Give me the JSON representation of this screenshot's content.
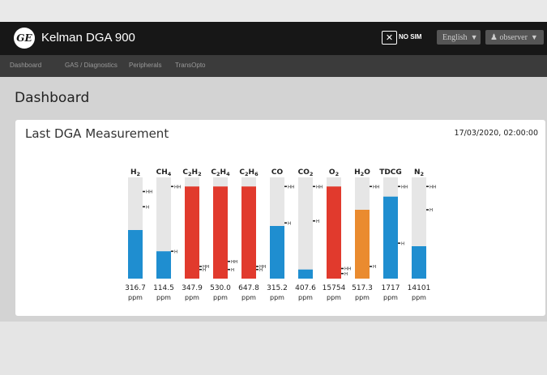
{
  "app": {
    "title": "Kelman DGA 900",
    "logo_text": "GE",
    "nosim_label": "NO SIM",
    "language": "English",
    "user": "observer"
  },
  "nav": [
    "Dashboard",
    "GAS / Diagnostics",
    "Peripherals",
    "TransOpto"
  ],
  "page": {
    "title": "Dashboard"
  },
  "card": {
    "title": "Last DGA Measurement",
    "timestamp": "17/03/2020, 02:00:00"
  },
  "colors": {
    "blue": "#1f8ed0",
    "red": "#e13a2d",
    "orange": "#ea8b2f",
    "track": "#e6e6e6"
  },
  "gases": [
    {
      "sym": "H",
      "sub": "2",
      "value": "316.7",
      "unit": "ppm",
      "fill": 0.48,
      "color": "blue",
      "hh": 0.86,
      "h": 0.71
    },
    {
      "sym": "CH",
      "sub": "4",
      "value": "114.5",
      "unit": "ppm",
      "fill": 0.27,
      "color": "blue",
      "hh": 0.91,
      "h": 0.27
    },
    {
      "sym": "C",
      "sub": "2",
      "sym2": "H",
      "sub2": "2",
      "value": "347.9",
      "unit": "ppm",
      "fill": 0.91,
      "color": "red",
      "hh": 0.12,
      "h": 0.09
    },
    {
      "sym": "C",
      "sub": "2",
      "sym2": "H",
      "sub2": "4",
      "value": "530.0",
      "unit": "ppm",
      "fill": 0.91,
      "color": "red",
      "hh": 0.17,
      "h": 0.09
    },
    {
      "sym": "C",
      "sub": "2",
      "sym2": "H",
      "sub2": "6",
      "value": "647.8",
      "unit": "ppm",
      "fill": 0.91,
      "color": "red",
      "hh": 0.12,
      "h": 0.09
    },
    {
      "sym": "CO",
      "sub": "",
      "value": "315.2",
      "unit": "ppm",
      "fill": 0.52,
      "color": "blue",
      "hh": 0.91,
      "h": 0.55
    },
    {
      "sym": "CO",
      "sub": "2",
      "value": "407.6",
      "unit": "ppm",
      "fill": 0.09,
      "color": "blue",
      "hh": 0.91,
      "h": 0.57
    },
    {
      "sym": "O",
      "sub": "2",
      "value": "15754",
      "unit": "ppm",
      "fill": 0.91,
      "color": "red",
      "hh": 0.1,
      "h": 0.05
    },
    {
      "sym": "H",
      "sub": "2",
      "sym2": "O",
      "sub2": "",
      "value": "517.3",
      "unit": "ppm",
      "fill": 0.68,
      "color": "orange",
      "hh": 0.91,
      "h": 0.12
    },
    {
      "sym": "TDCG",
      "sub": "",
      "value": "1717",
      "unit": "ppm",
      "fill": 0.81,
      "color": "blue",
      "hh": 0.91,
      "h": 0.35
    },
    {
      "sym": "N",
      "sub": "2",
      "value": "14101",
      "unit": "ppm",
      "fill": 0.32,
      "color": "blue",
      "hh": 0.91,
      "h": 0.68
    }
  ],
  "marker_labels": {
    "hh": "HH",
    "h": "H"
  }
}
